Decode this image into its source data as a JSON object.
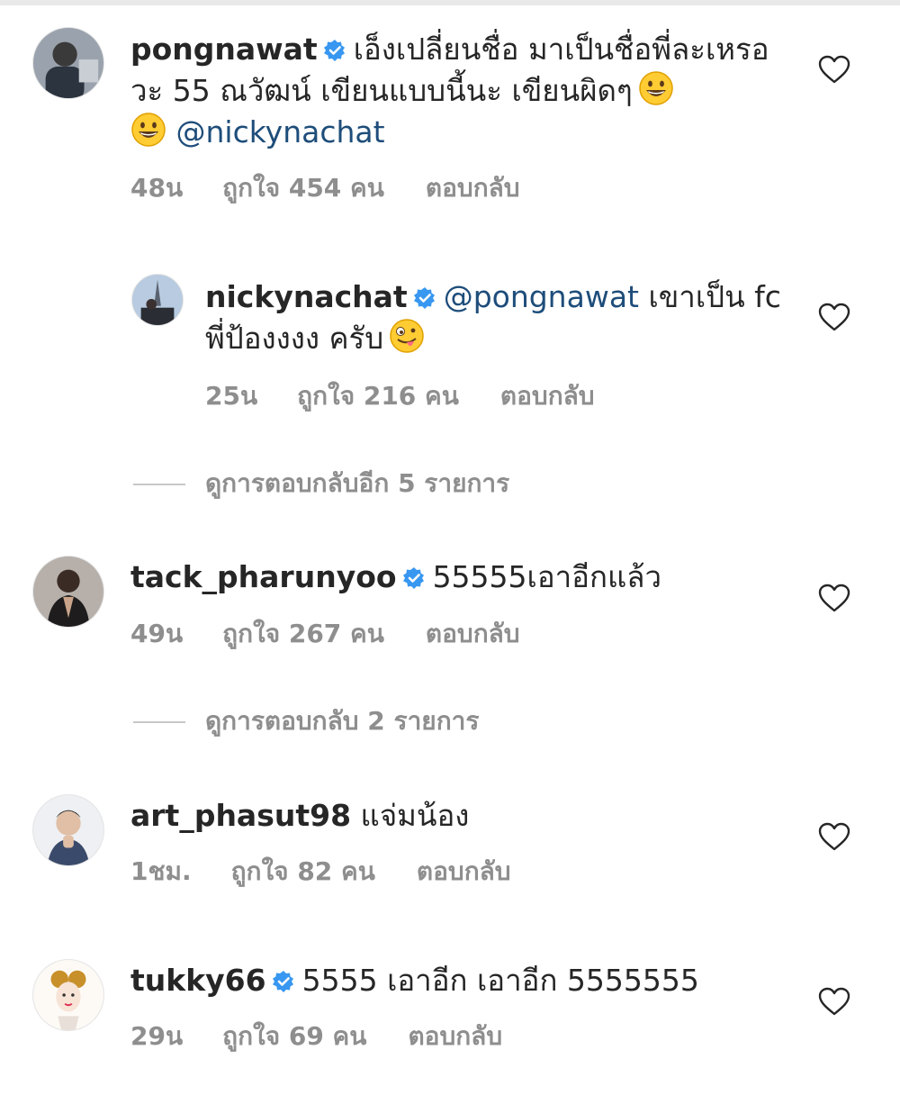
{
  "comments": [
    {
      "username": "pongnawat",
      "verified": true,
      "text": "เอ็งเปลี่ยนชื่อ มาเป็นชื่อพี่ละเหรอวะ 55 ณวัฒน์ เขียนแบบนี้นะ  เขียนผิดๆ",
      "emoji": "grinning-face",
      "emoji2": "grinning-face",
      "mention": "@nickynachat",
      "time": "48น",
      "likes": "ถูกใจ 454 คน",
      "reply": "ตอบกลับ"
    },
    {
      "username": "nickynachat",
      "verified": true,
      "mention": "@pongnawat",
      "text": " เขาเป็น fc พี่ป้องงงง ครับ",
      "emoji": "zany-face",
      "time": "25น",
      "likes": "ถูกใจ 216 คน",
      "reply": "ตอบกลับ"
    },
    {
      "username": "tack_pharunyoo",
      "verified": true,
      "text": "55555เอาอีกแล้ว",
      "time": "49น",
      "likes": "ถูกใจ 267 คน",
      "reply": "ตอบกลับ"
    },
    {
      "username": "art_phasut98",
      "verified": false,
      "text": "แจ่มน้อง",
      "time": "1ชม.",
      "likes": "ถูกใจ 82 คน",
      "reply": "ตอบกลับ"
    },
    {
      "username": "tukky66",
      "verified": true,
      "text": "5555 เอาอีก เอาอีก 5555555",
      "time": "29น",
      "likes": "ถูกใจ 69 คน",
      "reply": "ตอบกลับ"
    }
  ],
  "view_replies": [
    "ดูการตอบกลับอีก 5 รายการ",
    "ดูการตอบกลับ 2 รายการ"
  ],
  "icons": {
    "verified": "verified-badge-icon",
    "heart": "heart-outline-icon"
  },
  "colors": {
    "verified": "#3897f0",
    "mention": "#1e4d7a",
    "meta": "#8e8e8e"
  }
}
